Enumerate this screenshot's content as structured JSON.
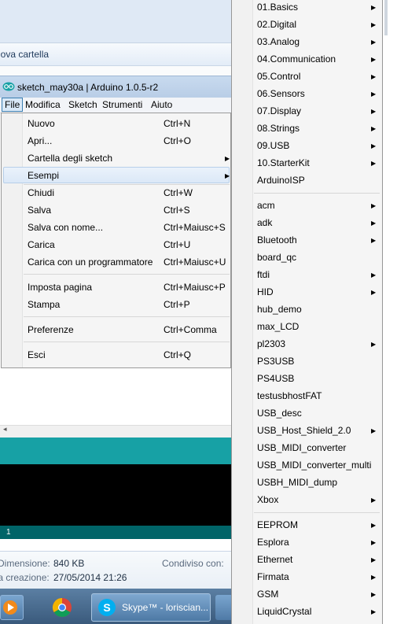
{
  "explorer": {
    "new_folder": "uova cartella",
    "details": {
      "dimension_label": "Dimensione:",
      "dimension_value": "840 KB",
      "shared_label": "Condiviso con:",
      "date_label": "ta creazione:",
      "date_value": "27/05/2014 21:26"
    }
  },
  "window": {
    "title": "sketch_may30a | Arduino 1.0.5-r2",
    "menus": [
      "File",
      "Modifica",
      "Sketch",
      "Strumenti",
      "Aiuto"
    ]
  },
  "file_menu": [
    {
      "label": "Nuovo",
      "shortcut": "Ctrl+N"
    },
    {
      "label": "Apri...",
      "shortcut": "Ctrl+O"
    },
    {
      "label": "Cartella degli sketch",
      "shortcut": "",
      "submenu": true
    },
    {
      "label": "Esempi",
      "shortcut": "",
      "submenu": true,
      "highlighted": true
    },
    {
      "label": "Chiudi",
      "shortcut": "Ctrl+W"
    },
    {
      "label": "Salva",
      "shortcut": "Ctrl+S"
    },
    {
      "label": "Salva con nome...",
      "shortcut": "Ctrl+Maiusc+S"
    },
    {
      "label": "Carica",
      "shortcut": "Ctrl+U"
    },
    {
      "label": "Carica con un programmatore",
      "shortcut": "Ctrl+Maiusc+U"
    },
    {
      "label": "Imposta pagina",
      "shortcut": "Ctrl+Maiusc+P"
    },
    {
      "label": "Stampa",
      "shortcut": "Ctrl+P"
    },
    {
      "label": "Preferenze",
      "shortcut": "Ctrl+Comma"
    },
    {
      "label": "Esci",
      "shortcut": "Ctrl+Q"
    }
  ],
  "editor": {
    "line_number": "1"
  },
  "examples_menu": [
    {
      "label": "01.Basics",
      "submenu": true
    },
    {
      "label": "02.Digital",
      "submenu": true
    },
    {
      "label": "03.Analog",
      "submenu": true
    },
    {
      "label": "04.Communication",
      "submenu": true
    },
    {
      "label": "05.Control",
      "submenu": true
    },
    {
      "label": "06.Sensors",
      "submenu": true
    },
    {
      "label": "07.Display",
      "submenu": true
    },
    {
      "label": "08.Strings",
      "submenu": true
    },
    {
      "label": "09.USB",
      "submenu": true
    },
    {
      "label": "10.StarterKit",
      "submenu": true
    },
    {
      "label": "ArduinoISP",
      "submenu": false
    },
    {
      "label": "acm",
      "submenu": true
    },
    {
      "label": "adk",
      "submenu": true
    },
    {
      "label": "Bluetooth",
      "submenu": true
    },
    {
      "label": "board_qc",
      "submenu": false
    },
    {
      "label": "ftdi",
      "submenu": true
    },
    {
      "label": "HID",
      "submenu": true
    },
    {
      "label": "hub_demo",
      "submenu": false
    },
    {
      "label": "max_LCD",
      "submenu": false
    },
    {
      "label": "pl2303",
      "submenu": true
    },
    {
      "label": "PS3USB",
      "submenu": false
    },
    {
      "label": "PS4USB",
      "submenu": false
    },
    {
      "label": "testusbhostFAT",
      "submenu": false
    },
    {
      "label": "USB_desc",
      "submenu": false
    },
    {
      "label": "USB_Host_Shield_2.0",
      "submenu": true
    },
    {
      "label": "USB_MIDI_converter",
      "submenu": false
    },
    {
      "label": "USB_MIDI_converter_multi",
      "submenu": false
    },
    {
      "label": "USBH_MIDI_dump",
      "submenu": false
    },
    {
      "label": "Xbox",
      "submenu": true
    },
    {
      "label": "EEPROM",
      "submenu": true
    },
    {
      "label": "Esplora",
      "submenu": true
    },
    {
      "label": "Ethernet",
      "submenu": true
    },
    {
      "label": "Firmata",
      "submenu": true
    },
    {
      "label": "GSM",
      "submenu": true
    },
    {
      "label": "LiquidCrystal",
      "submenu": true
    }
  ],
  "taskbar": {
    "skype_label": "Skype™ - loriscian..."
  },
  "colors": {
    "arduino_teal": "#17a1a5",
    "arduino_dark_teal": "#006468",
    "console_black": "#000000",
    "menu_highlight": "#dbe8f7"
  }
}
